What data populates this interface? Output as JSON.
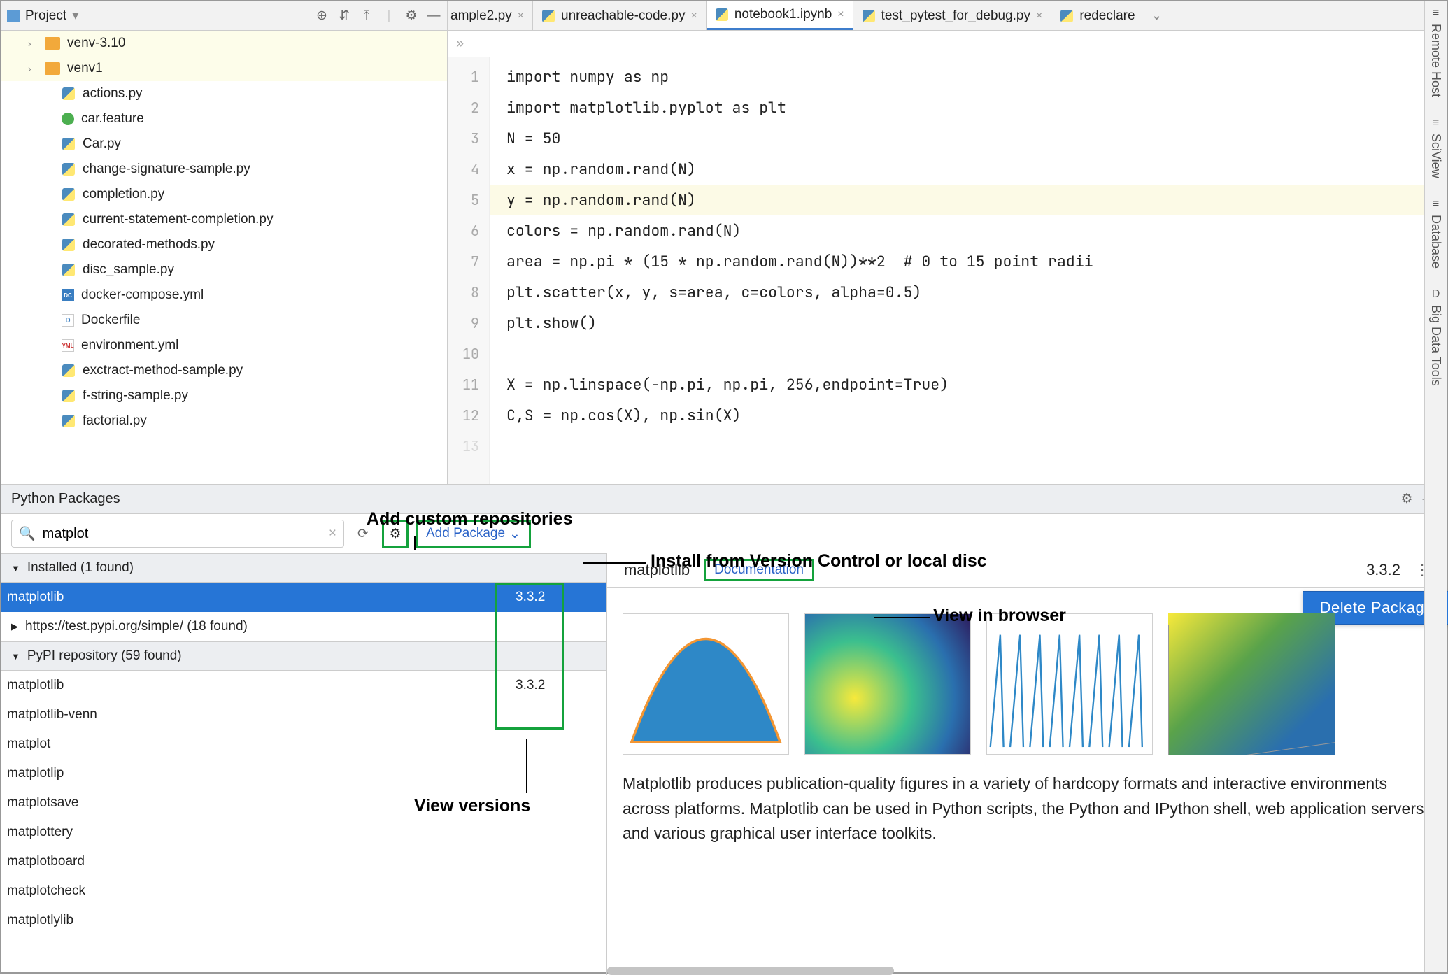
{
  "project": {
    "title": "Project",
    "tree": {
      "folders": [
        "venv-3.10",
        "venv1"
      ],
      "files": [
        {
          "name": "actions.py",
          "type": "py"
        },
        {
          "name": "car.feature",
          "type": "feature"
        },
        {
          "name": "Car.py",
          "type": "py"
        },
        {
          "name": "change-signature-sample.py",
          "type": "py"
        },
        {
          "name": "completion.py",
          "type": "py"
        },
        {
          "name": "current-statement-completion.py",
          "type": "py"
        },
        {
          "name": "decorated-methods.py",
          "type": "py"
        },
        {
          "name": "disc_sample.py",
          "type": "py"
        },
        {
          "name": "docker-compose.yml",
          "type": "dc"
        },
        {
          "name": "Dockerfile",
          "type": "d"
        },
        {
          "name": "environment.yml",
          "type": "yml"
        },
        {
          "name": "exctract-method-sample.py",
          "type": "py"
        },
        {
          "name": "f-string-sample.py",
          "type": "py"
        },
        {
          "name": "factorial.py",
          "type": "py"
        }
      ]
    }
  },
  "tabs": {
    "items": [
      {
        "label": "ample2.py",
        "active": false,
        "clipped": true
      },
      {
        "label": "unreachable-code.py",
        "active": false
      },
      {
        "label": "notebook1.ipynb",
        "active": true
      },
      {
        "label": "test_pytest_for_debug.py",
        "active": false
      },
      {
        "label": "redeclare",
        "active": false,
        "noclose": true
      }
    ]
  },
  "editor": {
    "breadcrumb": "»",
    "lines": [
      "import numpy as np",
      "import matplotlib.pyplot as plt",
      "N = 50",
      "x = np.random.rand(N)",
      "y = np.random.rand(N)",
      "colors = np.random.rand(N)",
      "area = np.pi * (15 * np.random.rand(N))**2  # 0 to 15 point radii",
      "plt.scatter(x, y, s=area, c=colors, alpha=0.5)",
      "plt.show()",
      "",
      "X = np.linspace(-np.pi, np.pi, 256,endpoint=True)",
      "C,S = np.cos(X), np.sin(X)"
    ],
    "highlighted_line_index": 4
  },
  "packages": {
    "panel_title": "Python Packages",
    "search_value": "matplot",
    "add_package_label": "Add Package",
    "groups": {
      "installed_header": "Installed (1 found)",
      "installed_item": {
        "name": "matplotlib",
        "version": "3.3.2"
      },
      "repo_header": "https://test.pypi.org/simple/ (18 found)",
      "pypi_header": "PyPI repository (59 found)",
      "pypi_items": [
        {
          "name": "matplotlib",
          "version": "3.3.2"
        },
        {
          "name": "matplotlib-venn",
          "version": ""
        },
        {
          "name": "matplot",
          "version": ""
        },
        {
          "name": "matplotlip",
          "version": ""
        },
        {
          "name": "matplotsave",
          "version": ""
        },
        {
          "name": "matplottery",
          "version": ""
        },
        {
          "name": "matplotboard",
          "version": ""
        },
        {
          "name": "matplotcheck",
          "version": ""
        },
        {
          "name": "matplotlylib",
          "version": ""
        }
      ]
    },
    "detail": {
      "name": "matplotlib",
      "doc_label": "Documentation",
      "version": "3.3.2",
      "delete_label": "Delete Package",
      "description": "Matplotlib produces publication-quality figures in a variety of hardcopy formats and interactive environments across platforms. Matplotlib can be used in Python scripts, the Python and IPython shell, web application servers, and various graphical user interface toolkits."
    }
  },
  "annotations": {
    "add_repos": "Add custom repositories",
    "install_vcs": "Install from Version Control or local disc",
    "view_browser": "View in browser",
    "view_versions": "View versions"
  },
  "sidebar": {
    "items": [
      "Remote Host",
      "SciView",
      "Database",
      "Big Data Tools"
    ]
  }
}
